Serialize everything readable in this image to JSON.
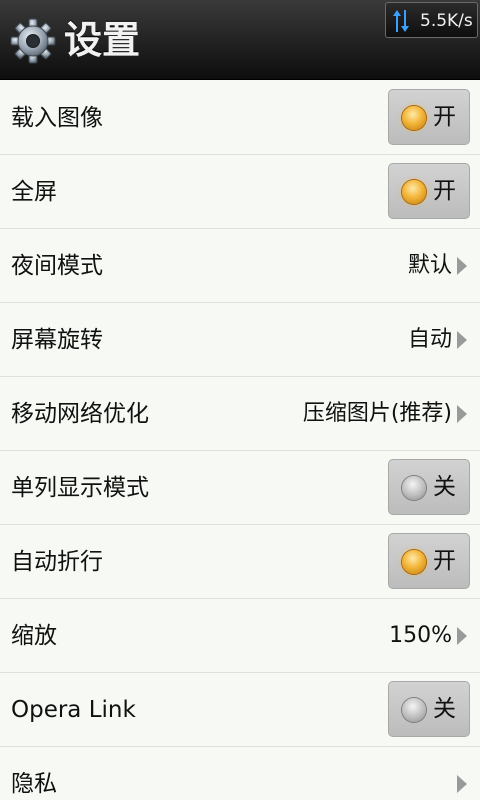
{
  "header": {
    "title": "设置",
    "icon": "gear-icon",
    "net_speed": "5.5K/s",
    "net_icon": "data-transfer-icon"
  },
  "settings": [
    {
      "label": "载入图像",
      "type": "toggle",
      "state": "开",
      "on": true
    },
    {
      "label": "全屏",
      "type": "toggle",
      "state": "开",
      "on": true
    },
    {
      "label": "夜间模式",
      "type": "option",
      "value": "默认"
    },
    {
      "label": "屏幕旋转",
      "type": "option",
      "value": "自动"
    },
    {
      "label": "移动网络优化",
      "type": "option",
      "value": "压缩图片(推荐)"
    },
    {
      "label": "单列显示模式",
      "type": "toggle",
      "state": "关",
      "on": false
    },
    {
      "label": "自动折行",
      "type": "toggle",
      "state": "开",
      "on": true
    },
    {
      "label": "缩放",
      "type": "option",
      "value": "150%"
    },
    {
      "label": "Opera Link",
      "type": "toggle",
      "state": "关",
      "on": false
    },
    {
      "label": "隐私",
      "type": "option",
      "value": ""
    }
  ],
  "colors": {
    "toggle_on": "#f3b63a",
    "toggle_off": "#bdbdbd",
    "header_bg": "#1a1a1a",
    "list_bg": "#f7faf4"
  }
}
